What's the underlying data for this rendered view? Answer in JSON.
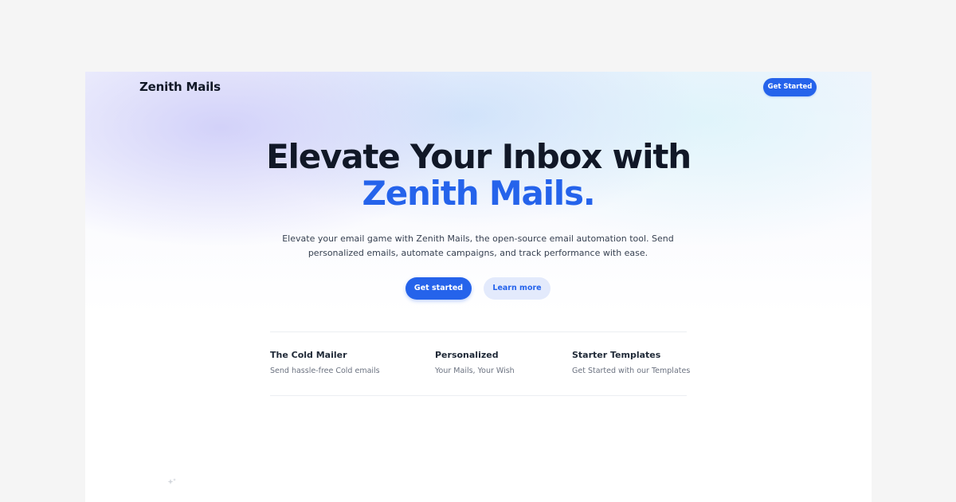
{
  "header": {
    "brand": "Zenith Mails",
    "cta_label": "Get Started"
  },
  "hero": {
    "title_line1": "Elevate Your Inbox with",
    "title_line2": "Zenith Mails.",
    "subtitle": "Elevate your email game with Zenith Mails, the open-source email automation tool. Send personalized emails, automate campaigns, and track performance with ease.",
    "primary_button": "Get started",
    "secondary_button": "Learn more"
  },
  "features": [
    {
      "title": "The Cold Mailer",
      "description": "Send hassle-free Cold emails"
    },
    {
      "title": "Personalized",
      "description": "Your Mails, Your Wish"
    },
    {
      "title": "Starter Templates",
      "description": "Get Started with our Templates"
    }
  ],
  "icons": {
    "decoration": "sparkle-icon"
  },
  "colors": {
    "accent": "#2563eb",
    "heading": "#111827",
    "body_text": "#374151",
    "muted_text": "#6b7280",
    "secondary_button_bg": "#e3eafc",
    "page_background": "#f5f5f5"
  }
}
